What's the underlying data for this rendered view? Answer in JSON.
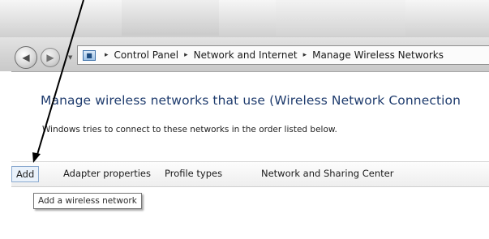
{
  "address_bar": {
    "location_icon": "control-panel-icon",
    "breadcrumbs": [
      "Control Panel",
      "Network and Internet",
      "Manage Wireless Networks"
    ],
    "separator": "▸"
  },
  "page": {
    "heading": "Manage wireless networks that use (Wireless Network Connection",
    "subtext": "Windows tries to connect to these networks in the order listed below."
  },
  "toolbar": {
    "add": "Add",
    "adapter_properties": "Adapter properties",
    "profile_types": "Profile types",
    "network_sharing_center": "Network and Sharing Center"
  },
  "tooltip": "Add a wireless network",
  "colors": {
    "heading": "#1f3c6e",
    "selected_button_border": "#8aa9cf",
    "selected_button_bg": "#eaf2fb"
  }
}
